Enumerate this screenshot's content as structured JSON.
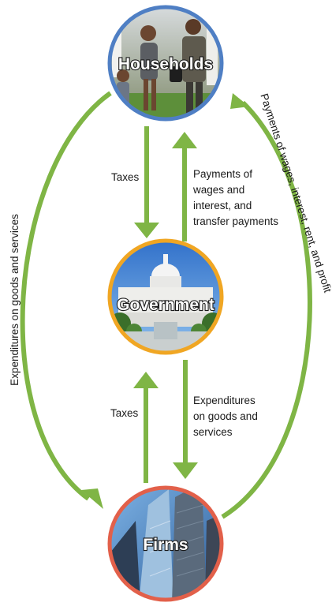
{
  "nodes": {
    "households": "Households",
    "government": "Government",
    "firms": "Firms"
  },
  "flows": {
    "taxes_from_households": "Taxes",
    "payments_to_households": [
      "Payments of",
      "wages and",
      "interest, and",
      "transfer payments"
    ],
    "taxes_from_firms": "Taxes",
    "government_expenditures": [
      "Expenditures",
      "on goods and",
      "services"
    ],
    "household_expenditures": "Expenditures on goods and services",
    "firm_payments": "Payments of wages, interest, rent, and profit"
  },
  "colors": {
    "arrow": "#7fb545",
    "households_ring": "#4f7fc4",
    "government_ring": "#f0a623",
    "firms_ring": "#e2604a"
  }
}
